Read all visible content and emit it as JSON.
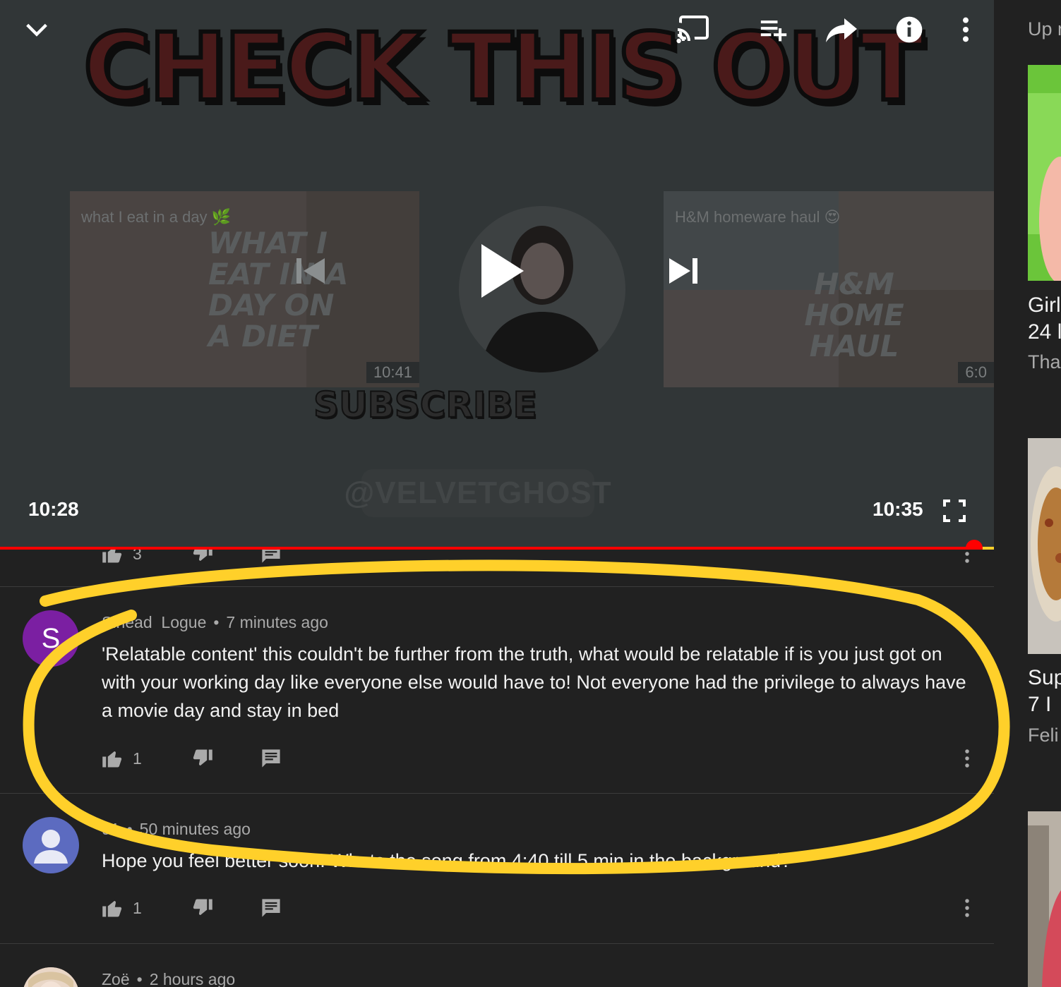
{
  "player": {
    "banner_text": "CHECK THIS OUT",
    "current_time": "10:28",
    "duration": "10:35",
    "progress_fraction": 0.98,
    "endscreen": {
      "left_video": {
        "title": "what I eat in a day 🌿",
        "thumb_text": "WHAT I EAT IN A DAY ON A DIET",
        "duration": "10:41"
      },
      "right_video": {
        "title": "H&M homeware haul 😍",
        "thumb_text": "H&M HOME HAUL",
        "duration": "6:0"
      },
      "subscribe_text": "SUBSCRIBE",
      "watermark": "@VELVETGHOST"
    },
    "icons": [
      "chevron-down-icon",
      "cast-icon",
      "add-to-playlist-icon",
      "share-icon",
      "info-icon",
      "more-vert-icon",
      "previous-icon",
      "play-icon",
      "next-icon",
      "fullscreen-icon"
    ]
  },
  "comments": {
    "prev_like_count": "3",
    "items": [
      {
        "avatar_letter": "S",
        "avatar_color": "#7b1fa2",
        "author": "Sinead  Logue",
        "time": "7 minutes ago",
        "text": "'Relatable content' this couldn't be further from the truth, what would be relatable if is you just got on with your working day like everyone else would have to! Not everyone had the privilege to always have a movie day and stay in bed",
        "likes": "1"
      },
      {
        "avatar_color": "#5c6bc0",
        "author": "91",
        "time": "50 minutes ago",
        "text": "Hope you feel better soon! Whats the song from 4:40 till 5 min in the background?",
        "likes": "1"
      },
      {
        "author": "Zoë",
        "time": "2 hours ago"
      }
    ]
  },
  "sidebar": {
    "up_next_label": "Up n",
    "items": [
      {
        "title_line1": "Girl",
        "title_line2": "24 l",
        "channel": "Tha"
      },
      {
        "title_line1": "Sup",
        "title_line2": "7  I",
        "channel": "Feli"
      }
    ]
  },
  "colors": {
    "accent_red": "#ff0000",
    "annotation_yellow": "#ffd02a",
    "background": "#212121"
  }
}
